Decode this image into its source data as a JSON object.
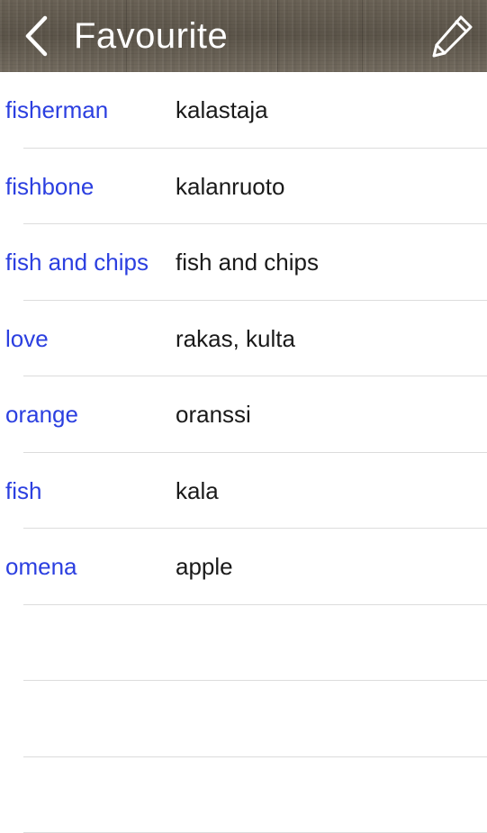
{
  "header": {
    "title": "Favourite",
    "back_icon": "chevron-left-icon",
    "edit_icon": "pencil-icon"
  },
  "colors": {
    "header_bg": "#5f584d",
    "term_text": "#2b3fe0",
    "translation_text": "#1a1a1a",
    "separator": "#dcdcdc"
  },
  "favourites": [
    {
      "term": "fisherman",
      "translation": "kalastaja"
    },
    {
      "term": "fishbone",
      "translation": "kalanruoto"
    },
    {
      "term": "fish and chips",
      "translation": "fish and chips"
    },
    {
      "term": "love",
      "translation": "rakas, kulta"
    },
    {
      "term": "orange",
      "translation": "oranssi"
    },
    {
      "term": "fish",
      "translation": "kala"
    },
    {
      "term": "omena",
      "translation": "apple"
    },
    {
      "term": "",
      "translation": ""
    },
    {
      "term": "",
      "translation": ""
    },
    {
      "term": "",
      "translation": ""
    }
  ]
}
